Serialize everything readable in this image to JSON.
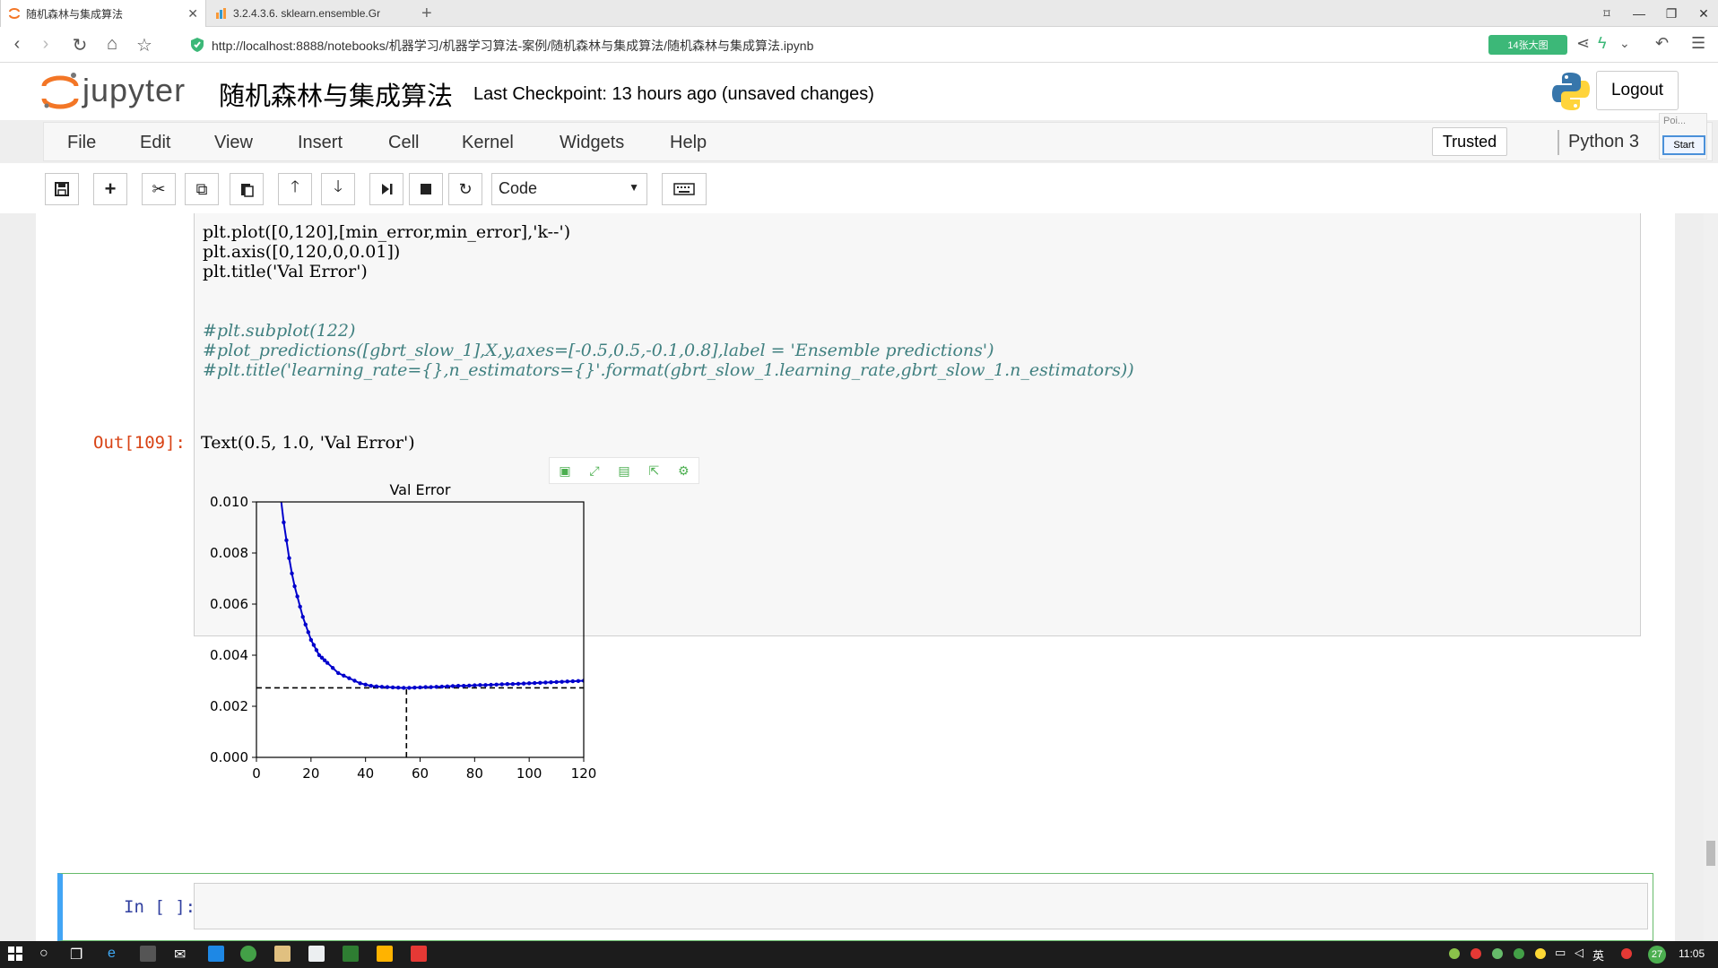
{
  "browser": {
    "tabs": [
      {
        "label": "随机森林与集成算法",
        "active": true
      },
      {
        "label": "3.2.4.3.6. sklearn.ensemble.Gr",
        "active": false
      }
    ],
    "new_tab": "+",
    "url": "http://localhost:8888/notebooks/机器学习/机器学习算法-案例/随机森林与集成算法/随机森林与集成算法.ipynb",
    "url_host": "localhost",
    "pill_label": "14张大图",
    "accent": "#3cb878"
  },
  "jupyter": {
    "logo_text": "jupyter",
    "notebook_name": "随机森林与集成算法",
    "checkpoint": "Last Checkpoint: 13 hours ago (unsaved changes)",
    "logout": "Logout",
    "menu": [
      "File",
      "Edit",
      "View",
      "Insert",
      "Cell",
      "Kernel",
      "Widgets",
      "Help"
    ],
    "trusted": "Trusted",
    "kernel": "Python 3",
    "popup_text": "Poi...",
    "popup_start": "Start",
    "cell_type": "Code",
    "toolbar_icons": [
      "save-icon",
      "plus-icon",
      "scissors-icon",
      "copy-icon",
      "paste-icon",
      "arrow-up-icon",
      "arrow-down-icon",
      "run-icon",
      "stop-icon",
      "restart-icon",
      "keyboard-icon"
    ]
  },
  "cell": {
    "code_lines": [
      {
        "text": "plt.plot([0,120],[min_error,min_error],'k--')",
        "comment": false
      },
      {
        "text": "plt.axis([0,120,0,0.01])",
        "comment": false
      },
      {
        "text": "plt.title('Val Error')",
        "comment": false
      },
      {
        "text": "",
        "comment": false
      },
      {
        "text": "#plt.subplot(122)",
        "comment": true
      },
      {
        "text": "#plot_predictions([gbrt_slow_1],X,y,axes=[-0.5,0.5,-0.1,0.8],label = 'Ensemble predictions')",
        "comment": true
      },
      {
        "text": "#plt.title('learning_rate={},n_estimators={}'.format(gbrt_slow_1.learning_rate,gbrt_slow_1.n_estimators))",
        "comment": true
      }
    ],
    "out_prompt": "Out[109]:",
    "out_text": "Text(0.5, 1.0, 'Val Error')",
    "in_prompt": "In [ ]:"
  },
  "chart_data": {
    "type": "line",
    "title": "Val Error",
    "xlim": [
      0,
      120
    ],
    "ylim": [
      0,
      0.01
    ],
    "xticks": [
      0,
      20,
      40,
      60,
      80,
      100,
      120
    ],
    "yticks": [
      "0.000",
      "0.002",
      "0.004",
      "0.006",
      "0.008",
      "0.010"
    ],
    "grid": false,
    "series": [
      {
        "color": "#0000cc",
        "style": "b.-",
        "x": [
          9,
          10,
          11,
          12,
          13,
          14,
          15,
          16,
          17,
          18,
          19,
          20,
          21,
          22,
          23,
          24,
          25,
          26,
          28,
          30,
          32,
          34,
          36,
          38,
          40,
          42,
          44,
          46,
          48,
          50,
          52,
          54,
          56,
          58,
          60,
          62,
          64,
          66,
          68,
          70,
          72,
          74,
          76,
          78,
          80,
          82,
          84,
          86,
          88,
          90,
          92,
          94,
          96,
          98,
          100,
          102,
          104,
          106,
          108,
          110,
          112,
          114,
          116,
          118,
          120
        ],
        "y": [
          0.0101,
          0.0092,
          0.0085,
          0.0078,
          0.0072,
          0.0067,
          0.0063,
          0.0059,
          0.0055,
          0.0052,
          0.0049,
          0.0046,
          0.0044,
          0.0042,
          0.004,
          0.0039,
          0.0038,
          0.0037,
          0.0035,
          0.0033,
          0.0032,
          0.0031,
          0.003,
          0.0029,
          0.00285,
          0.0028,
          0.00278,
          0.00276,
          0.00275,
          0.00274,
          0.00273,
          0.00272,
          0.00272,
          0.00273,
          0.00274,
          0.00275,
          0.00275,
          0.00276,
          0.00277,
          0.00278,
          0.00279,
          0.0028,
          0.0028,
          0.00281,
          0.00282,
          0.00283,
          0.00283,
          0.00284,
          0.00285,
          0.00286,
          0.00287,
          0.00287,
          0.00288,
          0.00289,
          0.0029,
          0.00291,
          0.00292,
          0.00293,
          0.00294,
          0.00295,
          0.00296,
          0.00297,
          0.00298,
          0.00299,
          0.003
        ]
      }
    ],
    "min_error": 0.00272,
    "best_n_estimators": 55
  },
  "taskbar": {
    "lang": "英",
    "badge": "27",
    "time": "11:05"
  }
}
